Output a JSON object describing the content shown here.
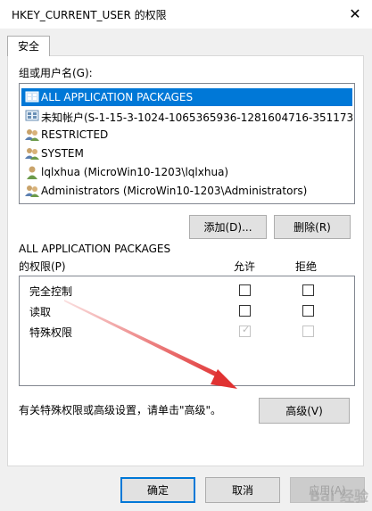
{
  "window": {
    "title": "HKEY_CURRENT_USER 的权限",
    "close": "✕"
  },
  "tab": {
    "label": "安全"
  },
  "groups": {
    "label": "组或用户名(G):",
    "items": [
      {
        "label": "ALL APPLICATION PACKAGES",
        "icon": "app-packages-icon",
        "selected": true
      },
      {
        "label": "未知帐户(S-1-15-3-1024-1065365936-1281604716-351173...",
        "icon": "unknown-account-icon",
        "selected": false
      },
      {
        "label": "RESTRICTED",
        "icon": "group-icon",
        "selected": false
      },
      {
        "label": "SYSTEM",
        "icon": "group-icon",
        "selected": false
      },
      {
        "label": "lqlxhua (MicroWin10-1203\\lqlxhua)",
        "icon": "user-icon",
        "selected": false
      },
      {
        "label": "Administrators (MicroWin10-1203\\Administrators)",
        "icon": "group-icon",
        "selected": false
      }
    ],
    "add_label": "添加(D)...",
    "remove_label": "删除(R)"
  },
  "permissions": {
    "for_name": "ALL APPLICATION PACKAGES",
    "label": "的权限(P)",
    "allow_header": "允许",
    "deny_header": "拒绝",
    "rows": [
      {
        "name": "完全控制",
        "allow": false,
        "deny": false,
        "disabled": false
      },
      {
        "name": "读取",
        "allow": false,
        "deny": false,
        "disabled": false
      },
      {
        "name": "特殊权限",
        "allow": true,
        "deny": false,
        "disabled": true
      }
    ]
  },
  "advanced": {
    "hint": "有关特殊权限或高级设置，请单击\"高级\"。",
    "button_label": "高级(V)"
  },
  "footer": {
    "ok_label": "确定",
    "cancel_label": "取消",
    "apply_label": "应用(A)"
  },
  "watermark": "Bai 经验",
  "colors": {
    "selection": "#0078d7",
    "arrow": "#e03232",
    "dialog_bg": "#f0f0f0"
  }
}
